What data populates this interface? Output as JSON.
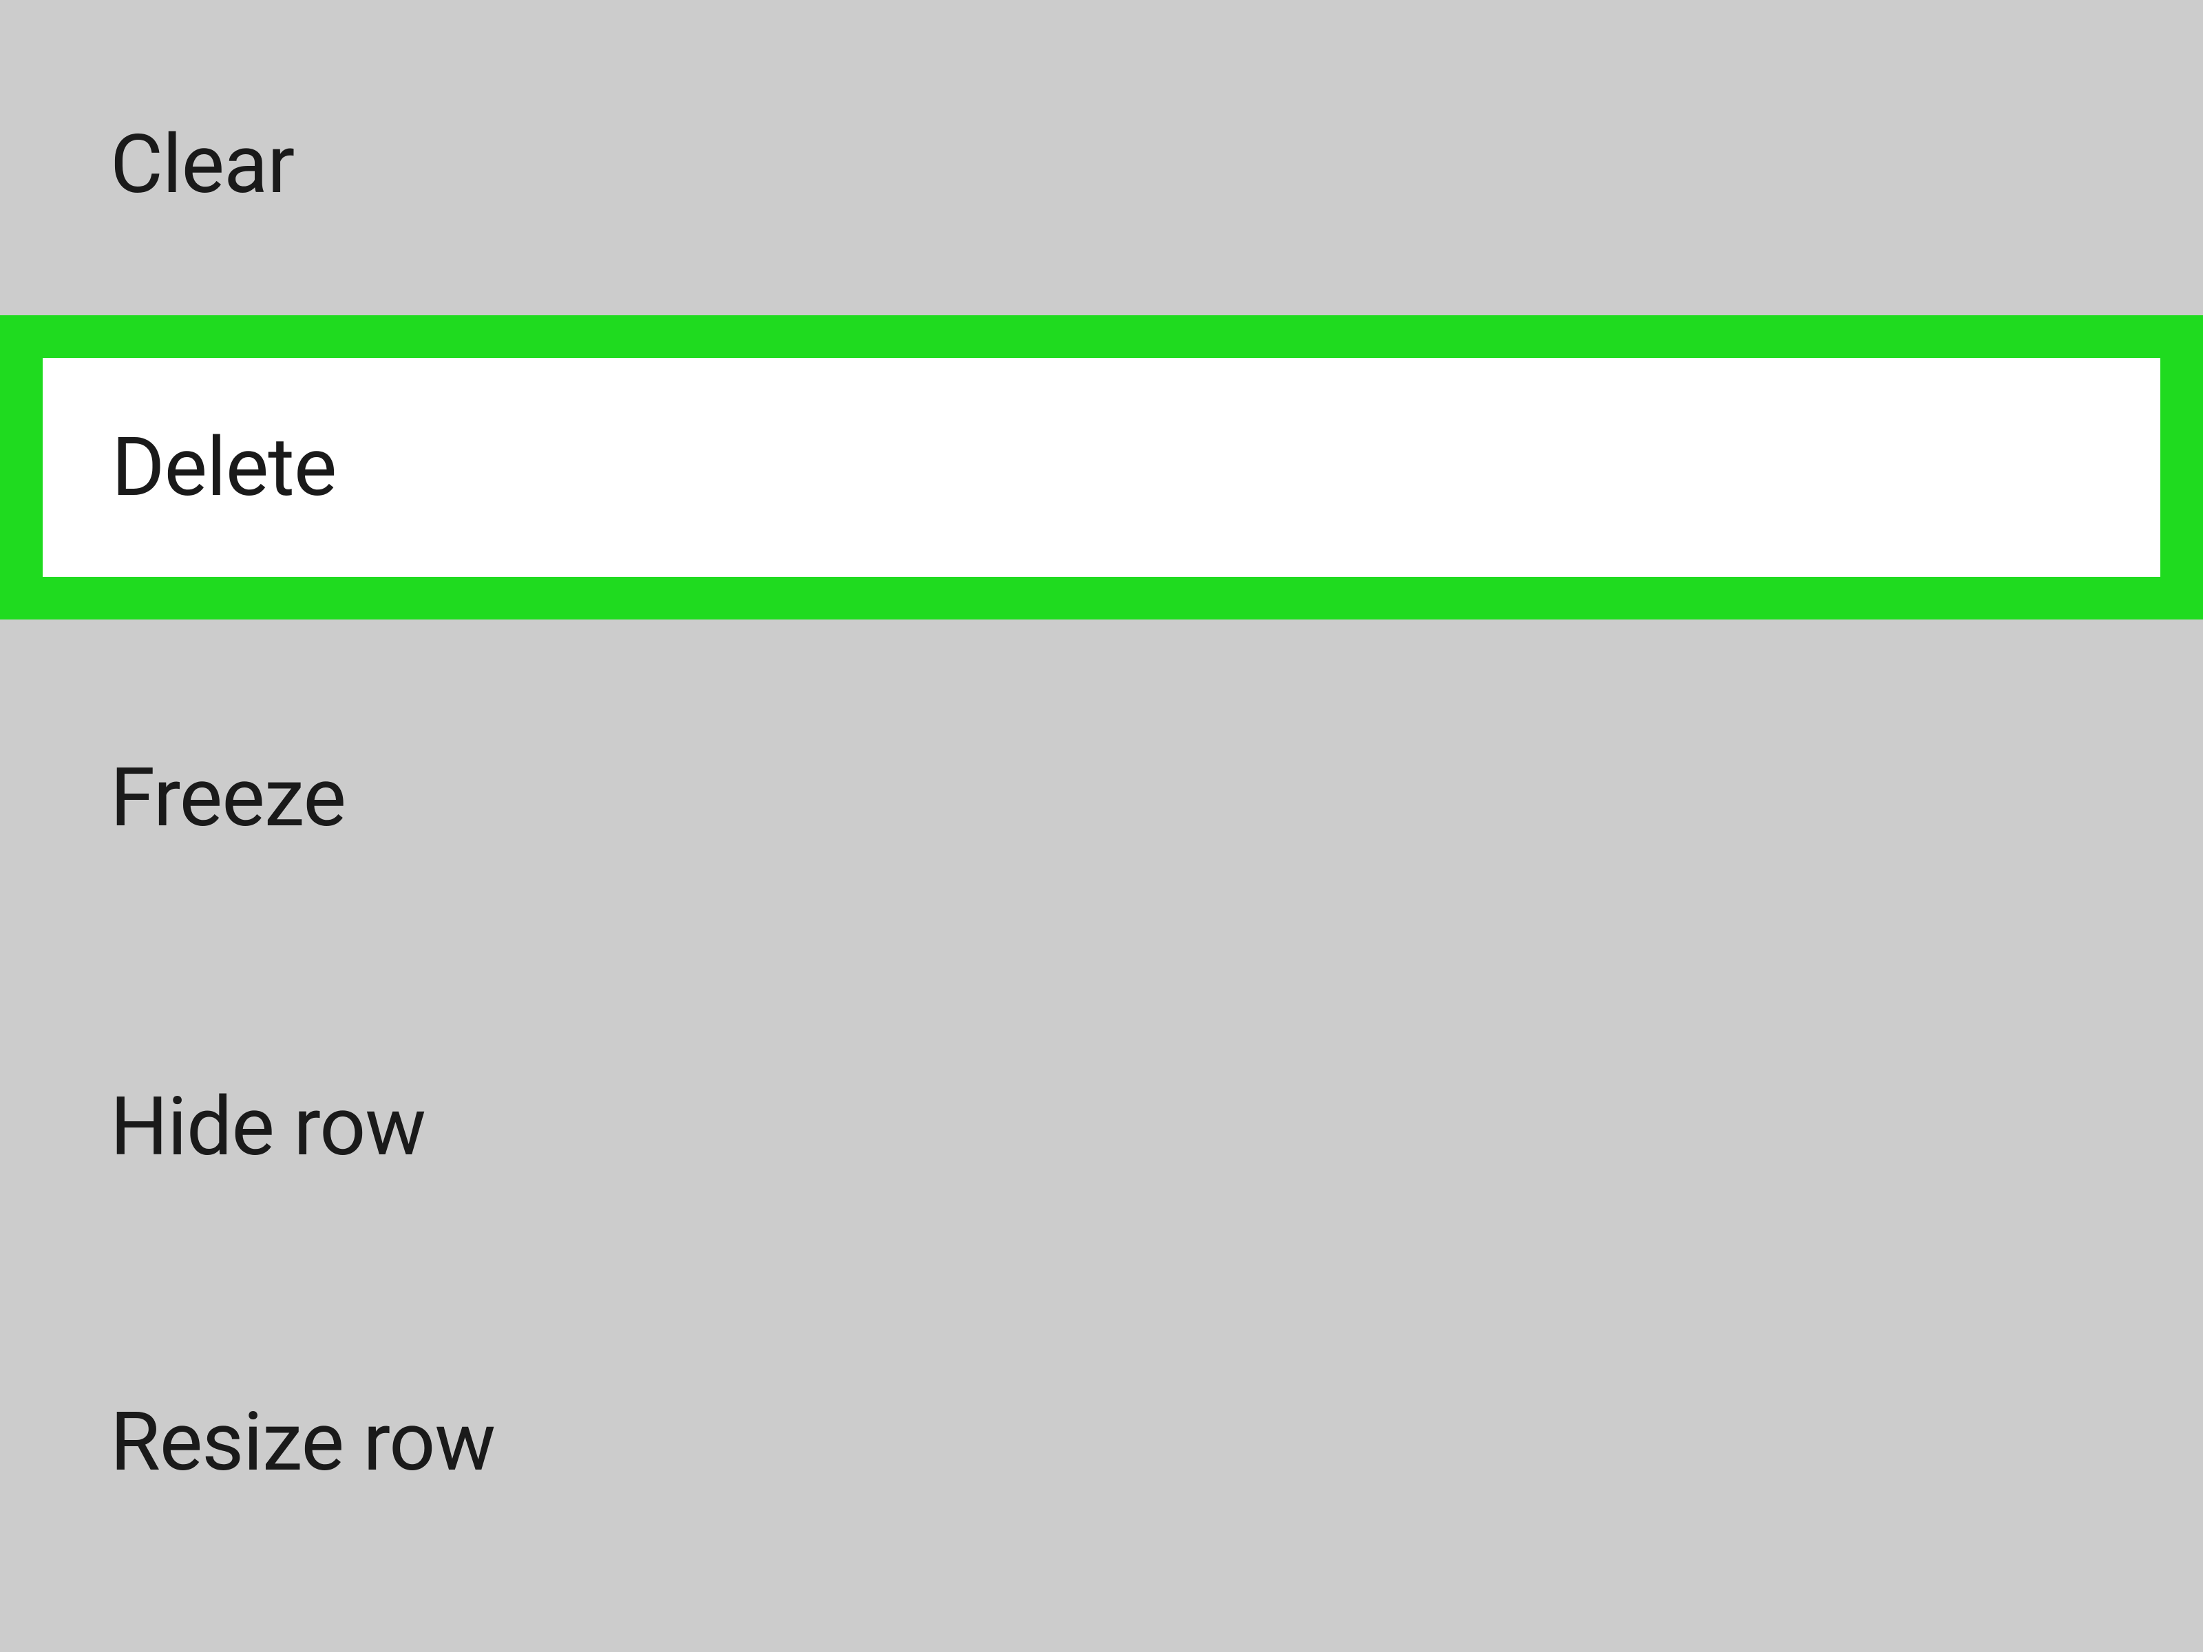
{
  "menu": {
    "items": [
      {
        "label": "Clear",
        "highlighted": false
      },
      {
        "label": "Delete",
        "highlighted": true
      },
      {
        "label": "Freeze",
        "highlighted": false
      },
      {
        "label": "Hide row",
        "highlighted": false
      },
      {
        "label": "Resize row",
        "highlighted": false
      }
    ]
  },
  "colors": {
    "background": "#cccccc",
    "highlight_border": "#1fdb1f",
    "highlight_inner": "#ffffff",
    "text": "#1a1a1a"
  }
}
